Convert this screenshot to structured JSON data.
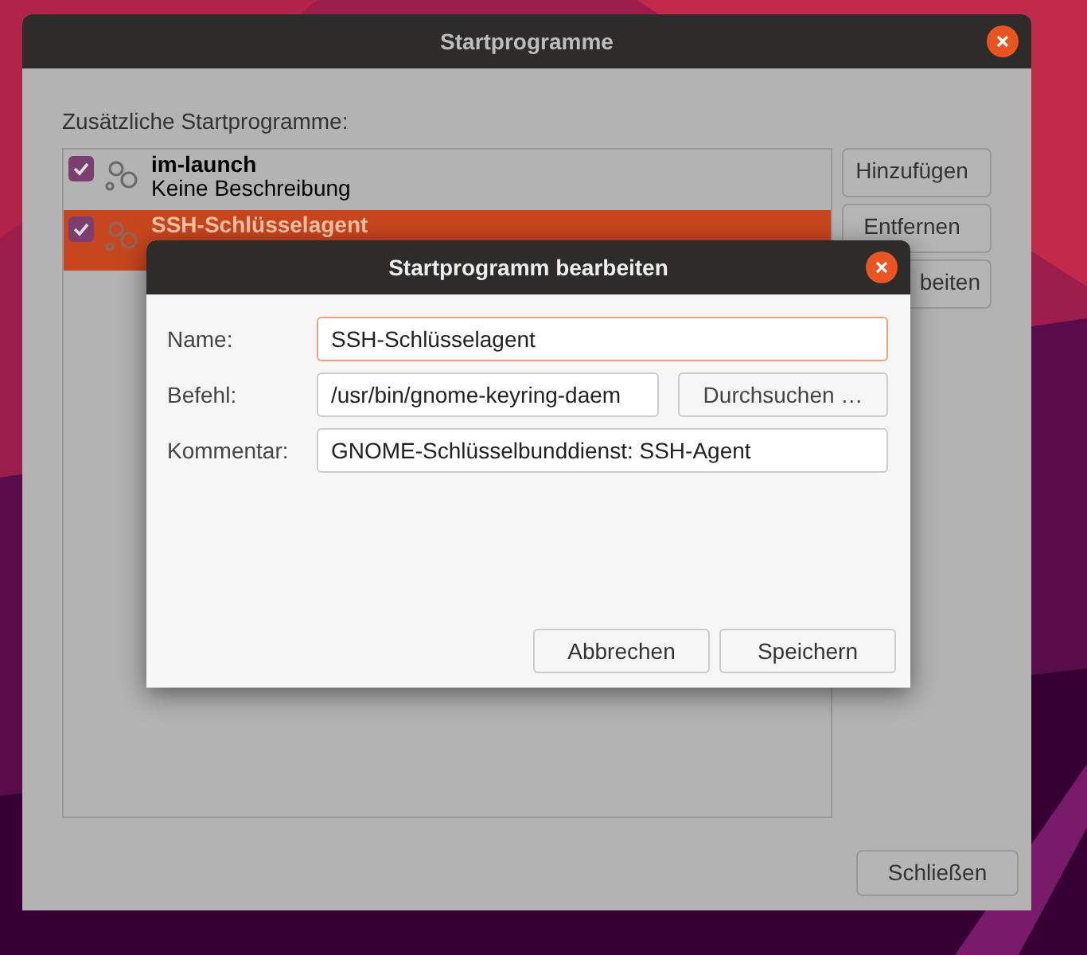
{
  "window": {
    "title": "Startprogramme"
  },
  "list_label": "Zusätzliche Startprogramme:",
  "programs": [
    {
      "name": "im-launch",
      "description": "Keine Beschreibung",
      "checked": true,
      "selected": false
    },
    {
      "name": "SSH-Schlüsselagent",
      "checked": true,
      "selected": true
    }
  ],
  "side_buttons": [
    "Hinzufügen",
    "Entfernen",
    "beiten"
  ],
  "close_button": "Schließen",
  "dialog": {
    "title": "Startprogramm bearbeiten",
    "fields": [
      {
        "label": "Name:",
        "value": "SSH-Schlüsselagent",
        "focused": true
      },
      {
        "label": "Befehl:",
        "value": "/usr/bin/gnome-keyring-daem",
        "focused": false,
        "button": "Durchsuchen …"
      },
      {
        "label": "Kommentar:",
        "value": "GNOME-Schlüsselbunddienst: SSH-Agent",
        "focused": false
      }
    ],
    "buttons": [
      "Abbrechen",
      "Speichern"
    ]
  }
}
